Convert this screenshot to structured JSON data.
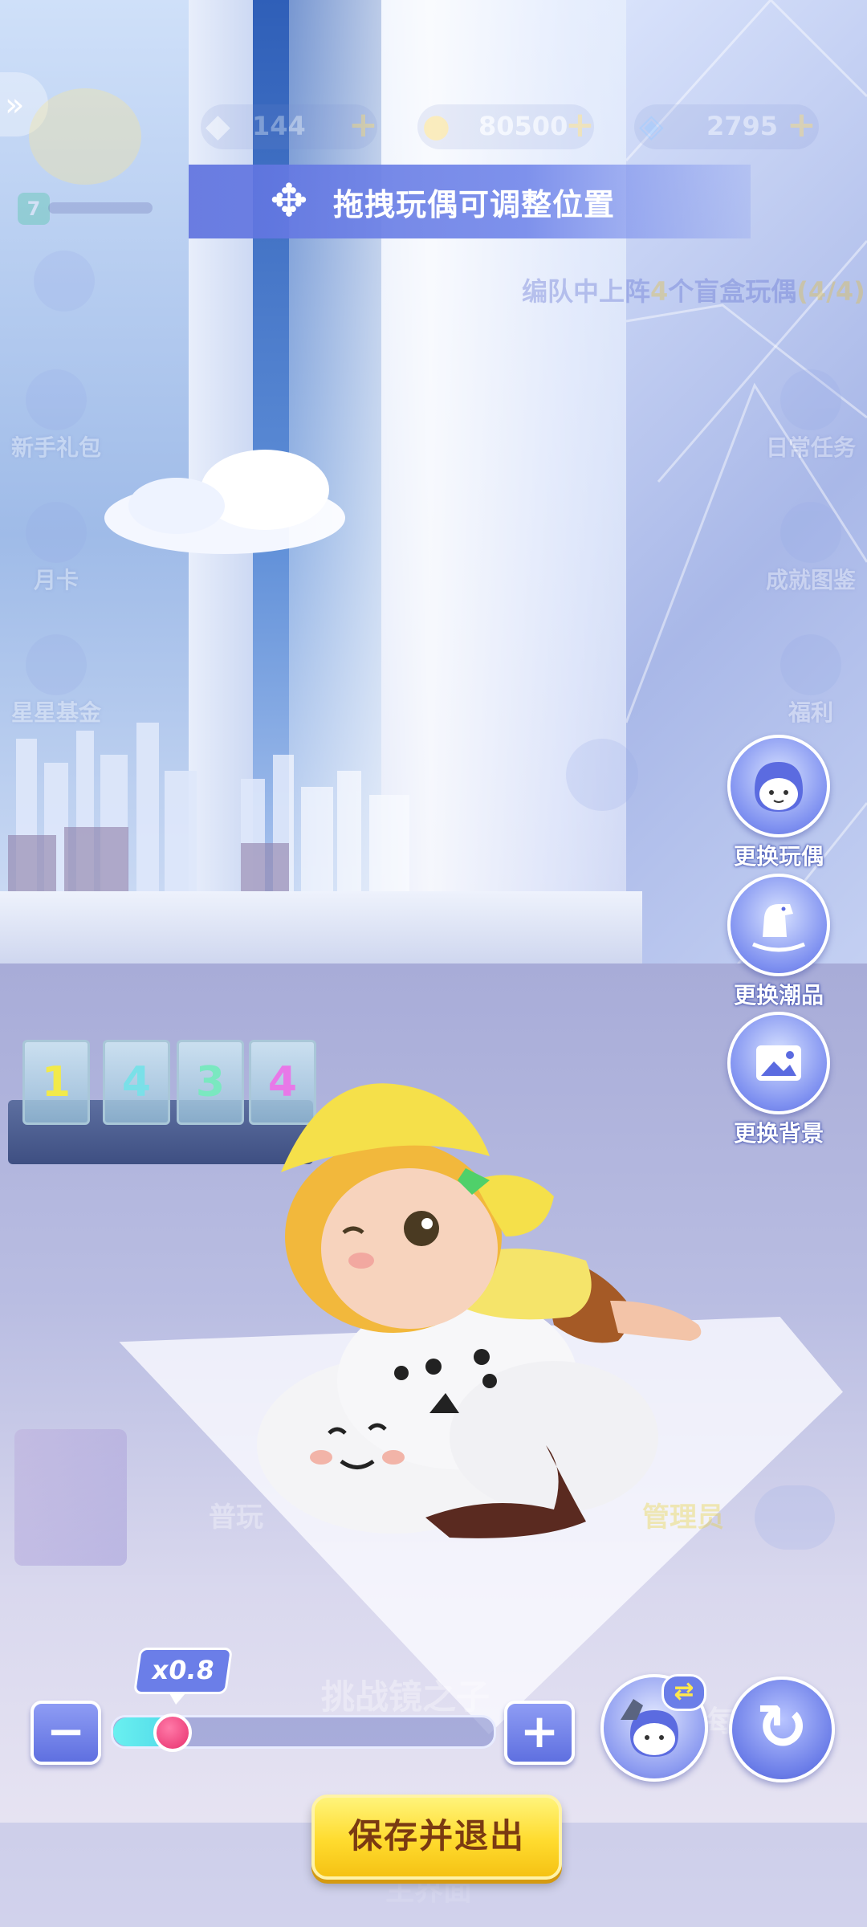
{
  "hud": {
    "level": "7",
    "currency_1": "144",
    "currency_2": "80500",
    "currency_3": "2795",
    "team_prompt_prefix": "编队中上阵",
    "team_prompt_count": "4",
    "team_prompt_suffix": "个盲盒玩偶",
    "team_prompt_progress": "(4/4)"
  },
  "left_menu": [
    {
      "label": "新手礼包",
      "icon": "gift-pack-icon"
    },
    {
      "label": "月卡",
      "icon": "calendar-card-icon"
    },
    {
      "label": "星星基金",
      "icon": "cart-icon"
    }
  ],
  "right_menu": [
    {
      "label": "日常任务",
      "icon": "task-icon"
    },
    {
      "label": "成就图鉴",
      "icon": "achievement-icon"
    },
    {
      "label": "福利",
      "icon": "gift-icon"
    }
  ],
  "toast": {
    "text": "拖拽玩偶可调整位置",
    "icon": "move-arrows-icon"
  },
  "side_buttons": [
    {
      "label": "更换玩偶",
      "icon": "doll-face-icon"
    },
    {
      "label": "更换潮品",
      "icon": "rocking-horse-icon"
    },
    {
      "label": "更换背景",
      "icon": "picture-icon"
    }
  ],
  "shelf_cubes": [
    "1",
    "4",
    "3",
    "4"
  ],
  "shelf_cube_colors": [
    "#f2ea4a",
    "#7ae0e8",
    "#7ae8c0",
    "#e878e8"
  ],
  "faded_labels": {
    "chat_prefix": "普玩",
    "chat_highlight": "管理员",
    "challenge": "挑战镜之子",
    "bottom_tab": "主界面",
    "sign": "每"
  },
  "controls": {
    "zoom_label": "x0.8",
    "zoom_value": 0.8,
    "zoom_fraction": 0.15,
    "minus": "−",
    "plus": "+",
    "swap_arrows": "⇄",
    "reset": "↻",
    "save_label": "保存并退出"
  },
  "colors": {
    "accent": "#6b7ee8",
    "save_yellow": "#ffdb2e",
    "slider_fill": "#4fd8e8",
    "knob_pink": "#e8306e"
  }
}
